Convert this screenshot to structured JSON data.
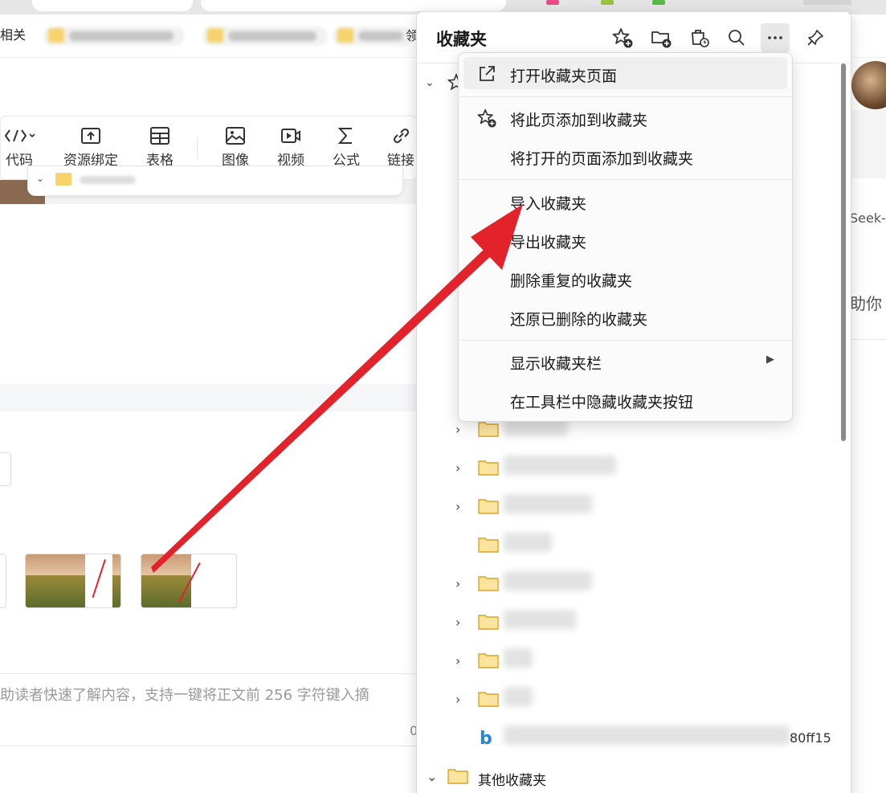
{
  "favorites_bar": {
    "left_label": "相关",
    "right_label": "领"
  },
  "editor_toolbar": {
    "items": [
      {
        "label": "代码",
        "icon": "code-icon"
      },
      {
        "label": "资源绑定",
        "icon": "upload-icon"
      },
      {
        "label": "表格",
        "icon": "table-icon"
      },
      {
        "label": "图像",
        "icon": "image-icon"
      },
      {
        "label": "视频",
        "icon": "video-icon"
      },
      {
        "label": "公式",
        "icon": "sigma-icon"
      },
      {
        "label": "链接",
        "icon": "link-icon"
      }
    ]
  },
  "abstract": {
    "text": "助读者快速了解内容，支持一键将正文前 256 字符键入摘",
    "counter": "0"
  },
  "right_page": {
    "seek_text": "Seek-",
    "help_text": "助你"
  },
  "favorites_panel": {
    "title": "收藏夹",
    "header_buttons": [
      {
        "name": "add-favorite-button",
        "icon": "star-plus-icon"
      },
      {
        "name": "add-folder-button",
        "icon": "folder-plus-icon"
      },
      {
        "name": "collections-button",
        "icon": "bag-icon"
      },
      {
        "name": "search-favorites-button",
        "icon": "search-icon"
      },
      {
        "name": "more-options-button",
        "icon": "ellipsis-icon"
      },
      {
        "name": "pin-panel-button",
        "icon": "pin-icon"
      }
    ],
    "bing_tail": "80ff15",
    "other_favorites_label": "其他收藏夹"
  },
  "more_menu": {
    "items": [
      {
        "label": "打开收藏夹页面",
        "icon": "open-external-icon"
      },
      {
        "label": "将此页添加到收藏夹",
        "icon": "star-plus-icon"
      },
      {
        "label": "将打开的页面添加到收藏夹",
        "icon": ""
      },
      {
        "label": "导入收藏夹",
        "icon": ""
      },
      {
        "label": "导出收藏夹",
        "icon": ""
      },
      {
        "label": "删除重复的收藏夹",
        "icon": ""
      },
      {
        "label": "还原已删除的收藏夹",
        "icon": ""
      },
      {
        "label": "显示收藏夹栏",
        "icon": "",
        "submenu": true
      },
      {
        "label": "在工具栏中隐藏收藏夹按钮",
        "icon": ""
      }
    ]
  },
  "colors": {
    "annotation_arrow": "#e2232b",
    "folder": "#f6c444",
    "bing": "#2684d8"
  }
}
